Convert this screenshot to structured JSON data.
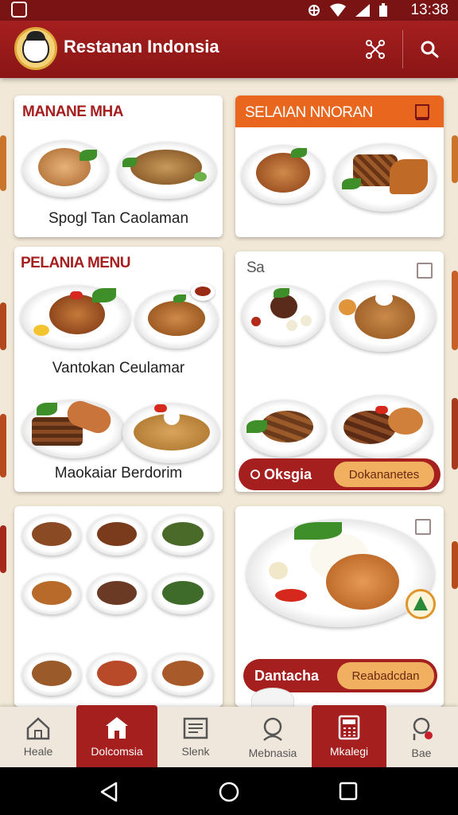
{
  "status_bar": {
    "time": "13:38"
  },
  "app_bar": {
    "title": "Restanan Indonsia"
  },
  "cards": {
    "card1": {
      "title": "MANANE MHA",
      "caption": "Spogl Tan Caolaman"
    },
    "card2": {
      "title": "SELAIAN NNORAN"
    },
    "card3": {
      "title": "PELANIA MENU",
      "caption_top": "Vantokan Ceulamar",
      "caption_bottom": "Maokaiar Berdorim"
    },
    "card4": {
      "title": "Sa",
      "pill_label": "Oksgia",
      "pill_button": "Dokananetes"
    },
    "card6": {
      "pill_label": "Dantacha",
      "pill_button": "Reabadcdan"
    }
  },
  "bottom_nav": [
    {
      "label": "Heale",
      "icon": "home-icon"
    },
    {
      "label": "Dolcomsia",
      "icon": "restaurant-icon",
      "active": true
    },
    {
      "label": "Slenk",
      "icon": "menu-list-icon"
    },
    {
      "label": "Mebnasia",
      "icon": "search-person-icon"
    },
    {
      "label": "Mkalegi",
      "icon": "calculator-icon",
      "active": true
    },
    {
      "label": "Bae",
      "icon": "profile-notification-icon"
    }
  ],
  "colors": {
    "primary": "#a51f1f",
    "accent_orange": "#e8661e",
    "pill_inner": "#f0b060",
    "background": "#f1e8d7"
  }
}
